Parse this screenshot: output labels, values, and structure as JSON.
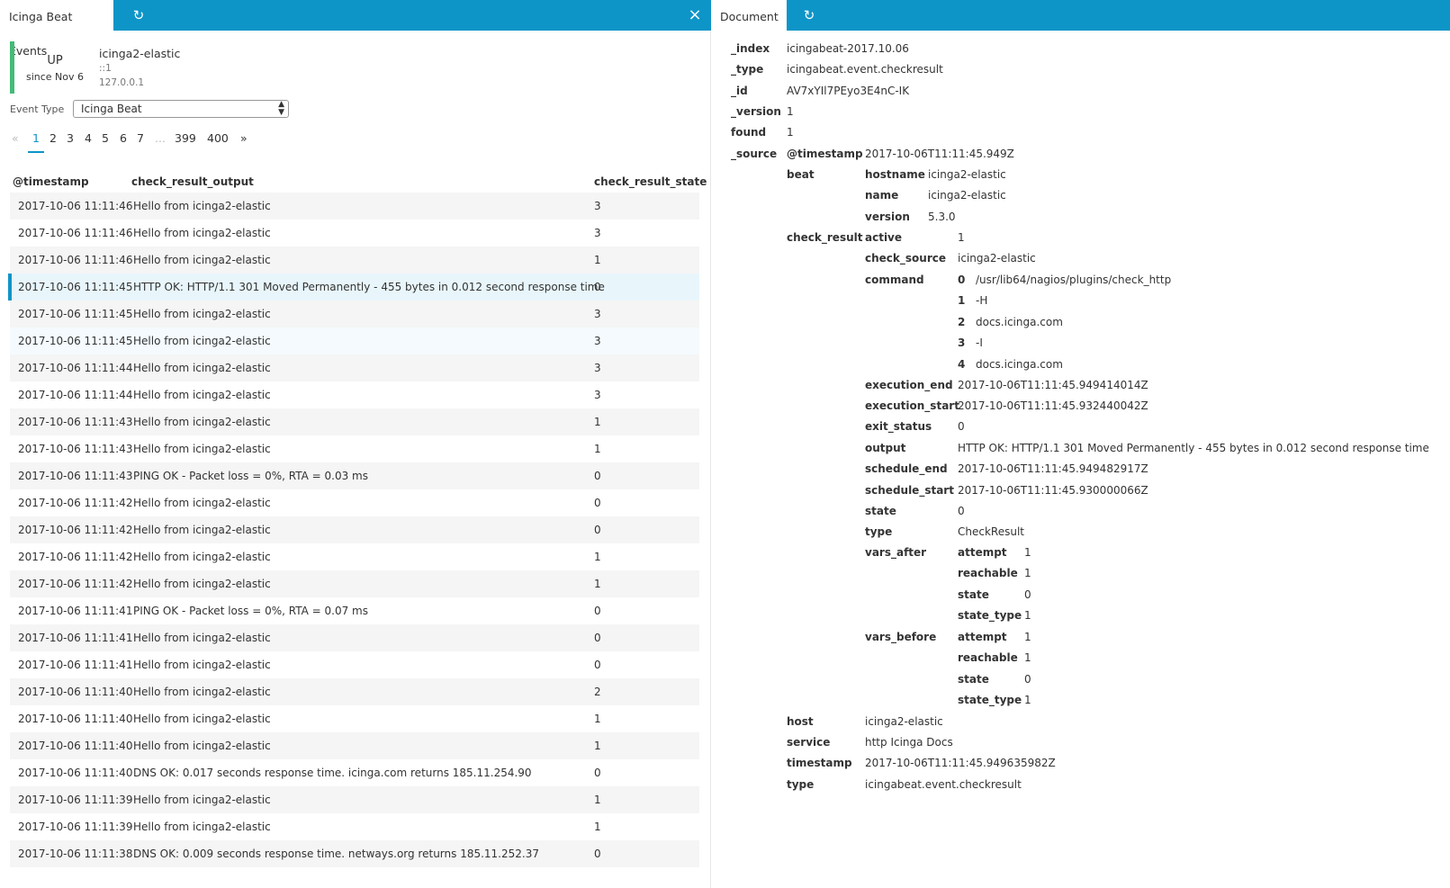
{
  "left_tab": {
    "title": "Icinga Beat Events",
    "refresh_icon": "↻",
    "close_icon": "×"
  },
  "right_tab": {
    "title": "Document",
    "refresh_icon": "↻"
  },
  "host": {
    "state": "UP",
    "since": "since Nov 6",
    "name": "icinga2-elastic",
    "address6": "::1",
    "address": "127.0.0.1",
    "state_color": "#44bb77"
  },
  "event_type": {
    "label": "Event Type",
    "selected": "Icinga Beat"
  },
  "pagination": {
    "prev": "«",
    "pages": [
      "1",
      "2",
      "3",
      "4",
      "5",
      "6",
      "7"
    ],
    "ellipsis": "...",
    "last_pages": [
      "399",
      "400"
    ],
    "next": "»",
    "current": "1"
  },
  "table": {
    "headers": [
      "@timestamp",
      "check_result_output",
      "check_result_state"
    ],
    "rows": [
      [
        "2017-10-06 11:11:46",
        "Hello from icinga2-elastic",
        "3"
      ],
      [
        "2017-10-06 11:11:46",
        "Hello from icinga2-elastic",
        "3"
      ],
      [
        "2017-10-06 11:11:46",
        "Hello from icinga2-elastic",
        "1"
      ],
      [
        "2017-10-06 11:11:45",
        "HTTP OK: HTTP/1.1 301 Moved Permanently - 455 bytes in 0.012 second response time",
        "0"
      ],
      [
        "2017-10-06 11:11:45",
        "Hello from icinga2-elastic",
        "3"
      ],
      [
        "2017-10-06 11:11:45",
        "Hello from icinga2-elastic",
        "3"
      ],
      [
        "2017-10-06 11:11:44",
        "Hello from icinga2-elastic",
        "3"
      ],
      [
        "2017-10-06 11:11:44",
        "Hello from icinga2-elastic",
        "3"
      ],
      [
        "2017-10-06 11:11:43",
        "Hello from icinga2-elastic",
        "1"
      ],
      [
        "2017-10-06 11:11:43",
        "Hello from icinga2-elastic",
        "1"
      ],
      [
        "2017-10-06 11:11:43",
        "PING OK - Packet loss = 0%, RTA = 0.03 ms",
        "0"
      ],
      [
        "2017-10-06 11:11:42",
        "Hello from icinga2-elastic",
        "0"
      ],
      [
        "2017-10-06 11:11:42",
        "Hello from icinga2-elastic",
        "0"
      ],
      [
        "2017-10-06 11:11:42",
        "Hello from icinga2-elastic",
        "1"
      ],
      [
        "2017-10-06 11:11:42",
        "Hello from icinga2-elastic",
        "1"
      ],
      [
        "2017-10-06 11:11:41",
        "PING OK - Packet loss = 0%, RTA = 0.07 ms",
        "0"
      ],
      [
        "2017-10-06 11:11:41",
        "Hello from icinga2-elastic",
        "0"
      ],
      [
        "2017-10-06 11:11:41",
        "Hello from icinga2-elastic",
        "0"
      ],
      [
        "2017-10-06 11:11:40",
        "Hello from icinga2-elastic",
        "2"
      ],
      [
        "2017-10-06 11:11:40",
        "Hello from icinga2-elastic",
        "1"
      ],
      [
        "2017-10-06 11:11:40",
        "Hello from icinga2-elastic",
        "1"
      ],
      [
        "2017-10-06 11:11:40",
        "DNS OK: 0.017 seconds response time. icinga.com returns 185.11.254.90",
        "0"
      ],
      [
        "2017-10-06 11:11:39",
        "Hello from icinga2-elastic",
        "1"
      ],
      [
        "2017-10-06 11:11:39",
        "Hello from icinga2-elastic",
        "1"
      ],
      [
        "2017-10-06 11:11:38",
        "DNS OK: 0.009 seconds response time. netways.org returns 185.11.252.37",
        "0"
      ]
    ]
  },
  "document": {
    "index_k": "_index",
    "index_v": "icingabeat-2017.10.06",
    "type_k": "_type",
    "type_v": "icingabeat.event.checkresult",
    "id_k": "_id",
    "id_v": "AV7xYIl7PEyo3E4nC-IK",
    "version_k": "_version",
    "version_v": "1",
    "found_k": "found",
    "found_v": "1",
    "source_k": "_source",
    "ts_k": "@timestamp",
    "ts_v": "2017-10-06T11:11:45.949Z",
    "beat_k": "beat",
    "hostname_k": "hostname",
    "hostname_v": "icinga2-elastic",
    "name_k": "name",
    "name_v": "icinga2-elastic",
    "bversion_k": "version",
    "bversion_v": "5.3.0",
    "cr_k": "check_result",
    "active_k": "active",
    "active_v": "1",
    "checksource_k": "check_source",
    "checksource_v": "icinga2-elastic",
    "command_k": "command",
    "cmd": [
      [
        "0",
        "/usr/lib64/nagios/plugins/check_http"
      ],
      [
        "1",
        "-H"
      ],
      [
        "2",
        "docs.icinga.com"
      ],
      [
        "3",
        "-I"
      ],
      [
        "4",
        "docs.icinga.com"
      ]
    ],
    "exend_k": "execution_end",
    "exend_v": "2017-10-06T11:11:45.949414014Z",
    "exstart_k": "execution_start",
    "exstart_v": "2017-10-06T11:11:45.932440042Z",
    "exit_k": "exit_status",
    "exit_v": "0",
    "output_k": "output",
    "output_v": "HTTP OK: HTTP/1.1 301 Moved Permanently - 455 bytes in 0.012 second response time",
    "schend_k": "schedule_end",
    "schend_v": "2017-10-06T11:11:45.949482917Z",
    "schstart_k": "schedule_start",
    "schstart_v": "2017-10-06T11:11:45.930000066Z",
    "state_k": "state",
    "state_v": "0",
    "crtype_k": "type",
    "crtype_v": "CheckResult",
    "va_k": "vars_after",
    "va": [
      [
        "attempt",
        "1"
      ],
      [
        "reachable",
        "1"
      ],
      [
        "state",
        "0"
      ],
      [
        "state_type",
        "1"
      ]
    ],
    "vb_k": "vars_before",
    "vb": [
      [
        "attempt",
        "1"
      ],
      [
        "reachable",
        "1"
      ],
      [
        "state",
        "0"
      ],
      [
        "state_type",
        "1"
      ]
    ],
    "host_k": "host",
    "host_v": "icinga2-elastic",
    "service_k": "service",
    "service_v": "http Icinga Docs",
    "timestamp_k": "timestamp",
    "timestamp_v": "2017-10-06T11:11:45.949635982Z",
    "stype_k": "type",
    "stype_v": "icingabeat.event.checkresult"
  }
}
